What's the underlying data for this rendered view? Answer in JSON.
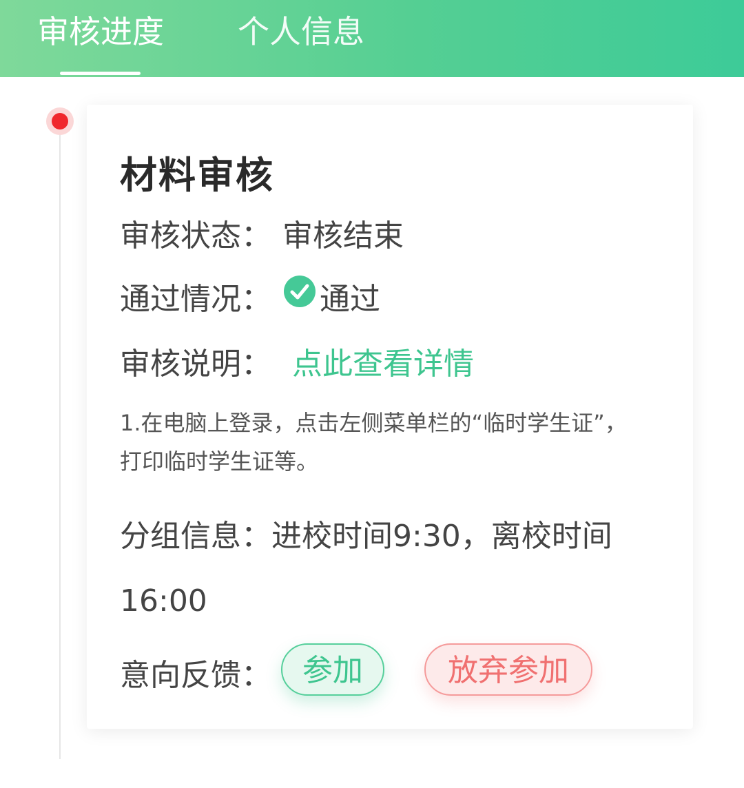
{
  "tabs": [
    {
      "label": "审核进度",
      "active": true
    },
    {
      "label": "个人信息",
      "active": false
    }
  ],
  "colors": {
    "accent": "#3ec58f",
    "header_start": "#7fd99a",
    "header_end": "#3dcb98",
    "timeline_dot": "#f0282d",
    "danger": "#f07070"
  },
  "card": {
    "title": "材料审核",
    "review_status_label": "审核状态：",
    "review_status_value": "审核结束",
    "pass_label": "通过情况：",
    "pass_icon": "check-circle-icon",
    "pass_value": "通过",
    "review_note_label": "审核说明：",
    "review_note_link": "点此查看详情",
    "note_text": "1.在电脑上登录，点击左侧菜单栏的“临时学生证”，打印临时学生证等。",
    "group_label": "分组信息：",
    "group_value": "进校时间9:30，离校时间16:00",
    "feedback_label": "意向反馈：",
    "join_button": "参加",
    "quit_button": "放弃参加"
  }
}
